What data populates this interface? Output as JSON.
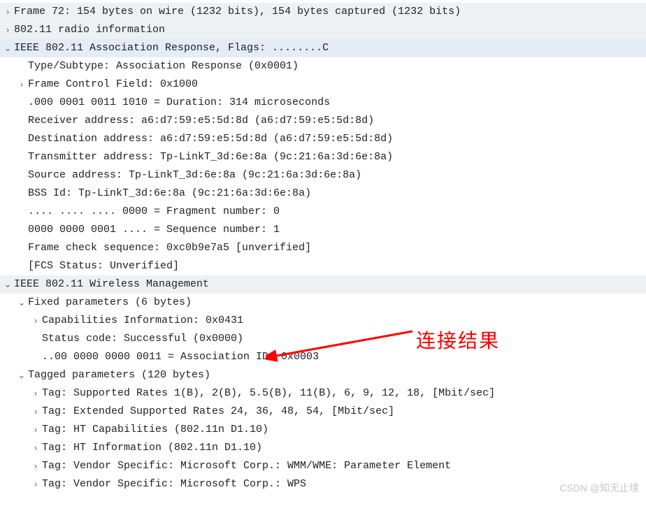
{
  "tree": {
    "frame_summary": "Frame 72: 154 bytes on wire (1232 bits), 154 bytes captured (1232 bits)",
    "radio_info": "802.11 radio information",
    "ieee_assoc_resp": "IEEE 802.11 Association Response, Flags: ........C",
    "type_subtype": "Type/Subtype: Association Response (0x0001)",
    "frame_control": "Frame Control Field: 0x1000",
    "duration": ".000 0001 0011 1010 = Duration: 314 microseconds",
    "receiver": "Receiver address: a6:d7:59:e5:5d:8d (a6:d7:59:e5:5d:8d)",
    "destination": "Destination address: a6:d7:59:e5:5d:8d (a6:d7:59:e5:5d:8d)",
    "transmitter": "Transmitter address: Tp-LinkT_3d:6e:8a (9c:21:6a:3d:6e:8a)",
    "source": "Source address: Tp-LinkT_3d:6e:8a (9c:21:6a:3d:6e:8a)",
    "bssid": "BSS Id: Tp-LinkT_3d:6e:8a (9c:21:6a:3d:6e:8a)",
    "fragment": ".... .... .... 0000 = Fragment number: 0",
    "sequence": "0000 0000 0001 .... = Sequence number: 1",
    "fcs": "Frame check sequence: 0xc0b9e7a5 [unverified]",
    "fcs_status": "[FCS Status: Unverified]",
    "wireless_mgmt": "IEEE 802.11 Wireless Management",
    "fixed_params": "Fixed parameters (6 bytes)",
    "capabilities": "Capabilities Information: 0x0431",
    "status_code": "Status code: Successful (0x0000)",
    "assoc_id": "..00 0000 0000 0011 = Association ID: 0x0003",
    "tagged_params": "Tagged parameters (120 bytes)",
    "tag_supported_rates": "Tag: Supported Rates 1(B), 2(B), 5.5(B), 11(B), 6, 9, 12, 18, [Mbit/sec]",
    "tag_ext_rates": "Tag: Extended Supported Rates 24, 36, 48, 54, [Mbit/sec]",
    "tag_ht_cap": "Tag: HT Capabilities (802.11n D1.10)",
    "tag_ht_info": "Tag: HT Information (802.11n D1.10)",
    "tag_vendor_wmm": "Tag: Vendor Specific: Microsoft Corp.: WMM/WME: Parameter Element",
    "tag_vendor_wps": "Tag: Vendor Specific: Microsoft Corp.: WPS"
  },
  "annotation": "连接结果",
  "watermark": "CSDN @知无止境",
  "icons": {
    "collapsed": "›",
    "expanded": "⌄"
  }
}
